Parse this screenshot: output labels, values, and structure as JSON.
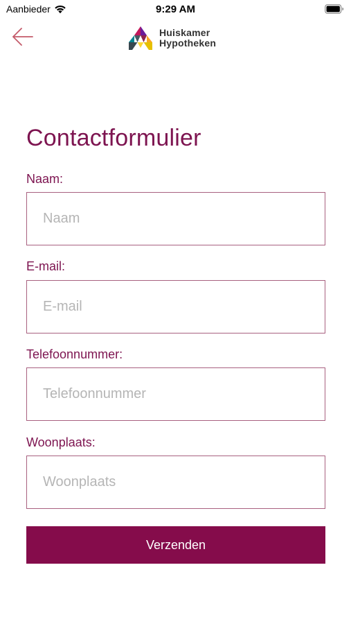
{
  "status_bar": {
    "carrier": "Aanbieder",
    "time": "9:29 AM"
  },
  "header": {
    "logo_line1": "Huiskamer",
    "logo_line2": "Hypotheken"
  },
  "form": {
    "title": "Contactformulier",
    "fields": [
      {
        "label": "Naam:",
        "placeholder": "Naam",
        "value": ""
      },
      {
        "label": "E-mail:",
        "placeholder": "E-mail",
        "value": ""
      },
      {
        "label": "Telefoonnummer:",
        "placeholder": "Telefoonnummer",
        "value": ""
      },
      {
        "label": "Woonplaats:",
        "placeholder": "Woonplaats",
        "value": ""
      }
    ],
    "submit_label": "Verzenden"
  },
  "colors": {
    "brand": "#850c4b",
    "label": "#7d1450",
    "input_border": "#a8607f",
    "placeholder": "#b5b5b5"
  },
  "icons": [
    "wifi-icon",
    "battery-icon",
    "back-arrow-icon",
    "house-logo-icon"
  ]
}
